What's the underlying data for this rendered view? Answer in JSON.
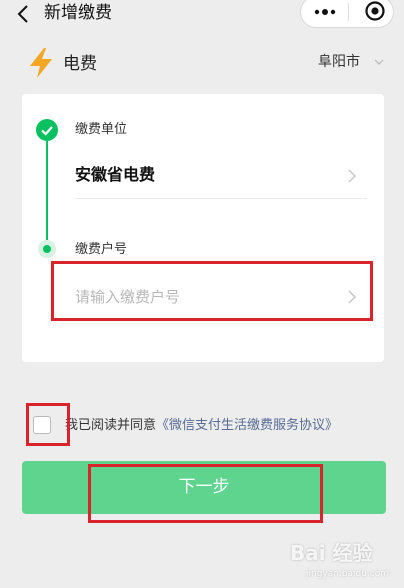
{
  "nav": {
    "title": "新增缴费",
    "back_icon": "back-arrow-icon",
    "more_icon": "more-dots-icon",
    "close_icon": "circle-target-icon"
  },
  "header": {
    "category_icon": "lightning-bolt-icon",
    "category_label": "电费",
    "city": "阜阳市",
    "accent_color": "#f5a623"
  },
  "form": {
    "step1_label": "缴费单位",
    "step1_value": "安徽省电费",
    "step2_label": "缴费户号",
    "step2_placeholder": "请输入缴费户号",
    "progress_color": "#07c160"
  },
  "agreement": {
    "text_prefix": "我已阅读并同意",
    "link_text": "《微信支付生活缴费服务协议》",
    "checked": false
  },
  "actions": {
    "next_label": "下一步",
    "button_color": "#5fd48f"
  },
  "watermark": {
    "brand": "Bai",
    "brand_suffix": "经验",
    "url": "jingyan.baidu.com"
  }
}
